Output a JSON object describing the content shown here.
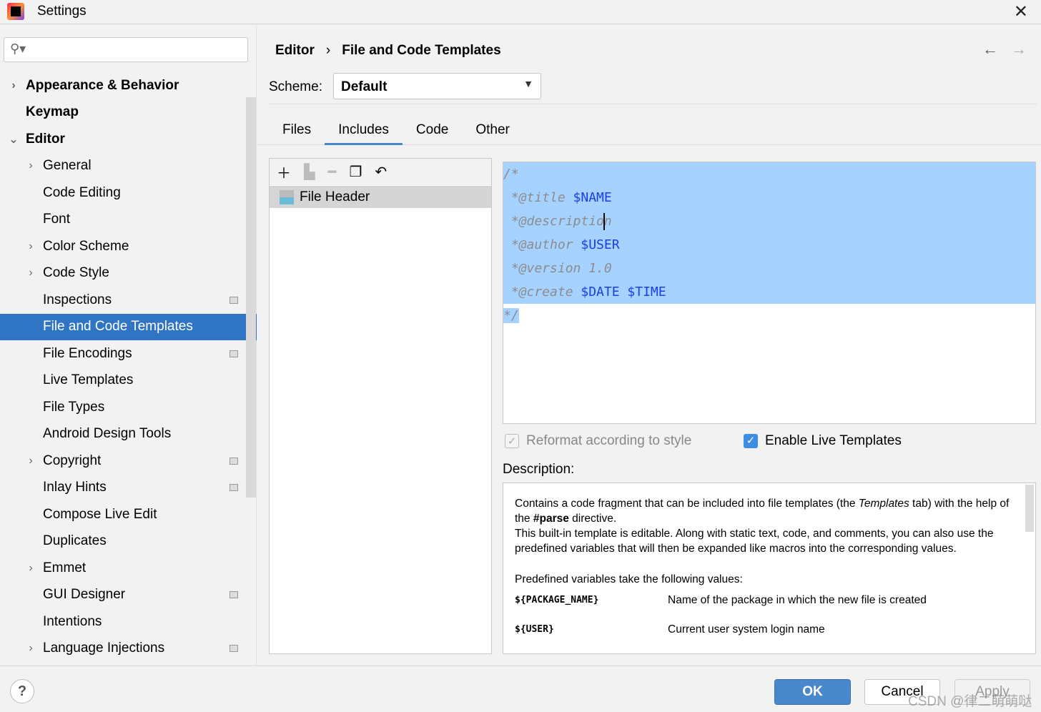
{
  "window": {
    "title": "Settings"
  },
  "search": {
    "placeholder": ""
  },
  "sidebar": {
    "items": [
      {
        "label": "Appearance & Behavior",
        "level": 0,
        "arrow": "right"
      },
      {
        "label": "Keymap",
        "level": 0
      },
      {
        "label": "Editor",
        "level": 0,
        "arrow": "down"
      },
      {
        "label": "General",
        "level": 1,
        "arrow": "right"
      },
      {
        "label": "Code Editing",
        "level": 1
      },
      {
        "label": "Font",
        "level": 1
      },
      {
        "label": "Color Scheme",
        "level": 1,
        "arrow": "right"
      },
      {
        "label": "Code Style",
        "level": 1,
        "arrow": "right"
      },
      {
        "label": "Inspections",
        "level": 1,
        "badge": true
      },
      {
        "label": "File and Code Templates",
        "level": 1,
        "selected": true
      },
      {
        "label": "File Encodings",
        "level": 1,
        "badge": true
      },
      {
        "label": "Live Templates",
        "level": 1
      },
      {
        "label": "File Types",
        "level": 1
      },
      {
        "label": "Android Design Tools",
        "level": 1
      },
      {
        "label": "Copyright",
        "level": 1,
        "arrow": "right",
        "badge": true
      },
      {
        "label": "Inlay Hints",
        "level": 1,
        "badge": true
      },
      {
        "label": "Compose Live Edit",
        "level": 1
      },
      {
        "label": "Duplicates",
        "level": 1
      },
      {
        "label": "Emmet",
        "level": 1,
        "arrow": "right"
      },
      {
        "label": "GUI Designer",
        "level": 1,
        "badge": true
      },
      {
        "label": "Intentions",
        "level": 1
      },
      {
        "label": "Language Injections",
        "level": 1,
        "arrow": "right",
        "badge": true
      }
    ]
  },
  "breadcrumb": {
    "parent": "Editor",
    "sep": "›",
    "current": "File and Code Templates"
  },
  "scheme": {
    "label": "Scheme:",
    "value": "Default"
  },
  "tabs": [
    "Files",
    "Includes",
    "Code",
    "Other"
  ],
  "active_tab": "Includes",
  "templates": {
    "items": [
      "File Header"
    ]
  },
  "editor": {
    "lines": [
      [
        {
          "t": "/*",
          "c": "cm"
        }
      ],
      [
        {
          "t": " *@title ",
          "c": "cm"
        },
        {
          "t": "$NAME",
          "c": "var"
        }
      ],
      [
        {
          "t": " *@descriptio",
          "c": "cm"
        },
        {
          "t": "n",
          "c": "cm",
          "caret": true
        }
      ],
      [
        {
          "t": " *@author ",
          "c": "cm"
        },
        {
          "t": "$USER",
          "c": "var"
        }
      ],
      [
        {
          "t": " *@version 1.0",
          "c": "cm"
        }
      ],
      [
        {
          "t": " *@create ",
          "c": "cm"
        },
        {
          "t": "$DATE $TIME",
          "c": "var"
        }
      ],
      [
        {
          "t": "*/",
          "c": "cm"
        }
      ]
    ]
  },
  "options": {
    "reformat": {
      "label": "Reformat according to style",
      "checked": true,
      "disabled": true
    },
    "live_templates": {
      "label": "Enable Live Templates",
      "checked": true
    }
  },
  "description": {
    "label": "Description:",
    "p1a": "Contains a code fragment that can be included into file templates (the ",
    "p1i": "Templates",
    "p1b": " tab) with the help of the ",
    "p1bold": "#parse",
    "p1c": " directive.",
    "p2": "This built-in template is editable. Along with static text, code, and comments, you can also use the predefined variables that will then be expanded like macros into the corresponding values.",
    "p3": "Predefined variables take the following values:",
    "vars": [
      {
        "name": "${PACKAGE_NAME}",
        "desc": "Name of the package in which the new file is created"
      },
      {
        "name": "${USER}",
        "desc": "Current user system login name"
      }
    ]
  },
  "buttons": {
    "help": "?",
    "ok": "OK",
    "cancel": "Cancel",
    "apply": "Apply"
  },
  "watermark": "CSDN @律二萌萌哒",
  "colors": {
    "selection": "#2f75c4",
    "accent": "#4a88cc",
    "code_selection": "#a6d2ff",
    "variable": "#1a3ee8"
  }
}
